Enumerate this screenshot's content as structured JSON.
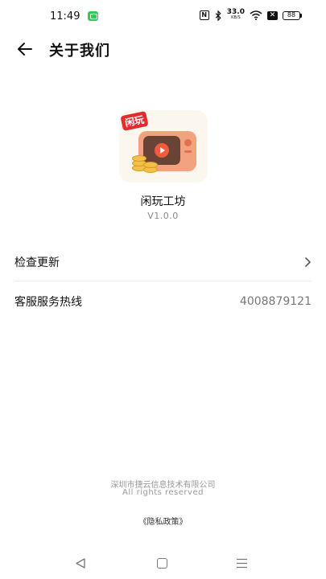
{
  "status_bar": {
    "time": "11:49",
    "nfc": "N",
    "net_speed": "33.0",
    "net_speed_unit": "KB/S",
    "battery": "88"
  },
  "header": {
    "title": "关于我们"
  },
  "app": {
    "logo_tag": "闲玩",
    "name": "闲玩工坊",
    "version": "V1.0.0"
  },
  "settings": {
    "check_update_label": "检查更新",
    "hotline_label": "客服服务热线",
    "hotline_number": "4008879121"
  },
  "footer": {
    "company": "深圳市捷云信息技术有限公司",
    "rights": "All rights reserved",
    "privacy_link": "《隐私政策》"
  },
  "colors": {
    "accent_red": "#e52b2b",
    "text_primary": "#111111",
    "text_secondary": "#777777"
  }
}
